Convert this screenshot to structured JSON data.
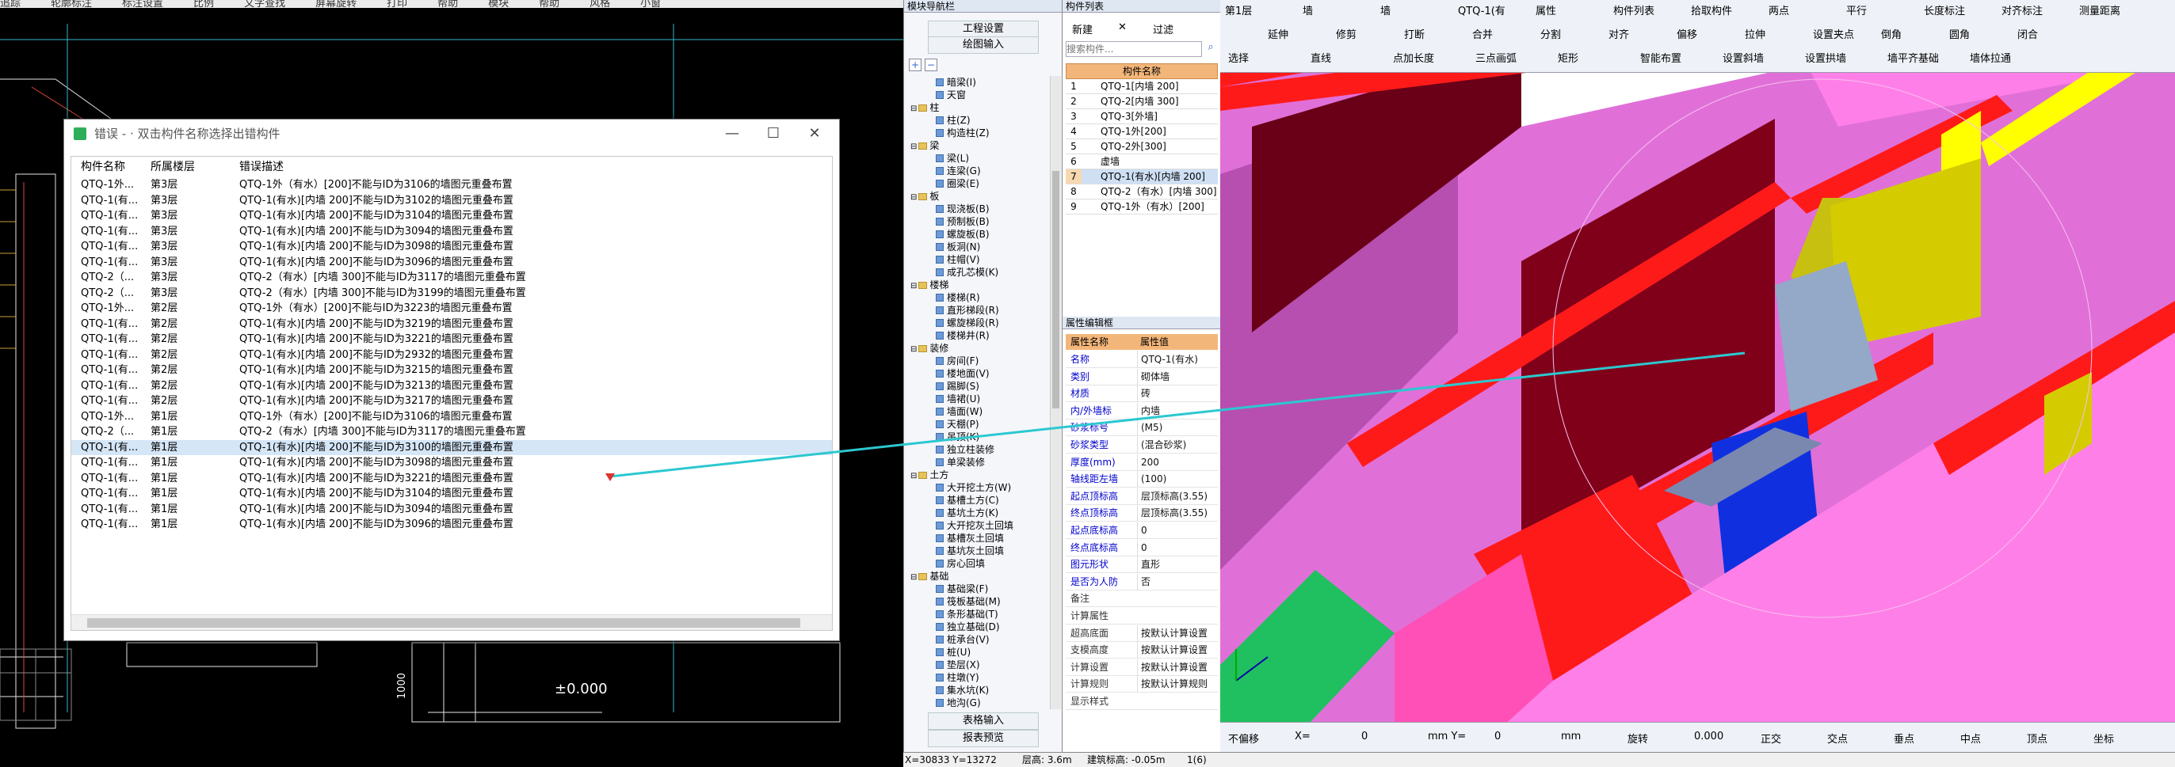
{
  "cad_menu": [
    "",
    "追踪",
    "轮廓标注",
    "标注设置",
    "比例",
    "文字查找",
    "屏幕旋转",
    "打印",
    "帮助",
    "模块",
    "",
    "帮助",
    "风格",
    "",
    "小窗"
  ],
  "cad_dimension": {
    "height_label": "1000",
    "elevation_label": "±0.000"
  },
  "error_dialog": {
    "title": "错误 - · 双击构件名称选择出错构件",
    "win_buttons": {
      "min": "—",
      "max": "☐",
      "close": "✕"
    },
    "columns": [
      "构件名称",
      "所属楼层",
      "错误描述"
    ],
    "rows": [
      {
        "name": "QTQ-1外...",
        "floor": "第3层",
        "desc": "QTQ-1外（有水）[200]不能与ID为3106的墙图元重叠布置"
      },
      {
        "name": "QTQ-1(有...",
        "floor": "第3层",
        "desc": "QTQ-1(有水)[内墙 200]不能与ID为3102的墙图元重叠布置"
      },
      {
        "name": "QTQ-1(有...",
        "floor": "第3层",
        "desc": "QTQ-1(有水)[内墙 200]不能与ID为3104的墙图元重叠布置"
      },
      {
        "name": "QTQ-1(有...",
        "floor": "第3层",
        "desc": "QTQ-1(有水)[内墙 200]不能与ID为3094的墙图元重叠布置"
      },
      {
        "name": "QTQ-1(有...",
        "floor": "第3层",
        "desc": "QTQ-1(有水)[内墙 200]不能与ID为3098的墙图元重叠布置"
      },
      {
        "name": "QTQ-1(有...",
        "floor": "第3层",
        "desc": "QTQ-1(有水)[内墙 200]不能与ID为3096的墙图元重叠布置"
      },
      {
        "name": "QTQ-2（...",
        "floor": "第3层",
        "desc": "QTQ-2（有水）[内墙 300]不能与ID为3117的墙图元重叠布置"
      },
      {
        "name": "QTQ-2（...",
        "floor": "第3层",
        "desc": "QTQ-2（有水）[内墙 300]不能与ID为3199的墙图元重叠布置"
      },
      {
        "name": "QTQ-1外...",
        "floor": "第2层",
        "desc": "QTQ-1外（有水）[200]不能与ID为3223的墙图元重叠布置"
      },
      {
        "name": "QTQ-1(有...",
        "floor": "第2层",
        "desc": "QTQ-1(有水)[内墙 200]不能与ID为3219的墙图元重叠布置"
      },
      {
        "name": "QTQ-1(有...",
        "floor": "第2层",
        "desc": "QTQ-1(有水)[内墙 200]不能与ID为3221的墙图元重叠布置"
      },
      {
        "name": "QTQ-1(有...",
        "floor": "第2层",
        "desc": "QTQ-1(有水)[内墙 200]不能与ID为2932的墙图元重叠布置"
      },
      {
        "name": "QTQ-1(有...",
        "floor": "第2层",
        "desc": "QTQ-1(有水)[内墙 200]不能与ID为3215的墙图元重叠布置"
      },
      {
        "name": "QTQ-1(有...",
        "floor": "第2层",
        "desc": "QTQ-1(有水)[内墙 200]不能与ID为3213的墙图元重叠布置"
      },
      {
        "name": "QTQ-1(有...",
        "floor": "第2层",
        "desc": "QTQ-1(有水)[内墙 200]不能与ID为3217的墙图元重叠布置"
      },
      {
        "name": "QTQ-1外...",
        "floor": "第1层",
        "desc": "QTQ-1外（有水）[200]不能与ID为3106的墙图元重叠布置"
      },
      {
        "name": "QTQ-2（...",
        "floor": "第1层",
        "desc": "QTQ-2（有水）[内墙 300]不能与ID为3117的墙图元重叠布置"
      },
      {
        "name": "QTQ-1(有...",
        "floor": "第1层",
        "desc": "QTQ-1(有水)[内墙 200]不能与ID为3100的墙图元重叠布置"
      },
      {
        "name": "QTQ-1(有...",
        "floor": "第1层",
        "desc": "QTQ-1(有水)[内墙 200]不能与ID为3098的墙图元重叠布置"
      },
      {
        "name": "QTQ-1(有...",
        "floor": "第1层",
        "desc": "QTQ-1(有水)[内墙 200]不能与ID为3221的墙图元重叠布置"
      },
      {
        "name": "QTQ-1(有...",
        "floor": "第1层",
        "desc": "QTQ-1(有水)[内墙 200]不能与ID为3104的墙图元重叠布置"
      },
      {
        "name": "QTQ-1(有...",
        "floor": "第1层",
        "desc": "QTQ-1(有水)[内墙 200]不能与ID为3094的墙图元重叠布置"
      },
      {
        "name": "QTQ-1(有...",
        "floor": "第1层",
        "desc": "QTQ-1(有水)[内墙 200]不能与ID为3096的墙图元重叠布置"
      }
    ],
    "selected_row_index": 17
  },
  "nav_panel": {
    "title": "模块导航栏",
    "buttons": [
      "工程设置",
      "绘图输入"
    ],
    "tree": [
      {
        "label": "暗梁(I)",
        "type": "item"
      },
      {
        "label": "天窗",
        "type": "item"
      },
      {
        "label": "柱",
        "type": "folder"
      },
      {
        "label": "柱(Z)",
        "type": "item"
      },
      {
        "label": "构造柱(Z)",
        "type": "item"
      },
      {
        "label": "梁",
        "type": "folder"
      },
      {
        "label": "梁(L)",
        "type": "item"
      },
      {
        "label": "连梁(G)",
        "type": "item"
      },
      {
        "label": "圈梁(E)",
        "type": "item"
      },
      {
        "label": "板",
        "type": "folder"
      },
      {
        "label": "现浇板(B)",
        "type": "item"
      },
      {
        "label": "预制板(B)",
        "type": "item"
      },
      {
        "label": "螺旋板(B)",
        "type": "item"
      },
      {
        "label": "板洞(N)",
        "type": "item"
      },
      {
        "label": "柱帽(V)",
        "type": "item"
      },
      {
        "label": "成孔芯模(K)",
        "type": "item"
      },
      {
        "label": "楼梯",
        "type": "folder"
      },
      {
        "label": "楼梯(R)",
        "type": "item"
      },
      {
        "label": "直形梯段(R)",
        "type": "item"
      },
      {
        "label": "螺旋梯段(R)",
        "type": "item"
      },
      {
        "label": "楼梯井(R)",
        "type": "item"
      },
      {
        "label": "装修",
        "type": "folder"
      },
      {
        "label": "房间(F)",
        "type": "item"
      },
      {
        "label": "楼地面(V)",
        "type": "item"
      },
      {
        "label": "踢脚(S)",
        "type": "item"
      },
      {
        "label": "墙裙(U)",
        "type": "item"
      },
      {
        "label": "墙面(W)",
        "type": "item"
      },
      {
        "label": "天棚(P)",
        "type": "item"
      },
      {
        "label": "吊顶(K)",
        "type": "item"
      },
      {
        "label": "独立柱装修",
        "type": "item"
      },
      {
        "label": "单梁装修",
        "type": "item"
      },
      {
        "label": "土方",
        "type": "folder"
      },
      {
        "label": "大开挖土方(W)",
        "type": "item"
      },
      {
        "label": "基槽土方(C)",
        "type": "item"
      },
      {
        "label": "基坑土方(K)",
        "type": "item"
      },
      {
        "label": "大开挖灰土回填",
        "type": "item"
      },
      {
        "label": "基槽灰土回填",
        "type": "item"
      },
      {
        "label": "基坑灰土回填",
        "type": "item"
      },
      {
        "label": "房心回填",
        "type": "item"
      },
      {
        "label": "基础",
        "type": "folder"
      },
      {
        "label": "基础梁(F)",
        "type": "item"
      },
      {
        "label": "筏板基础(M)",
        "type": "item"
      },
      {
        "label": "条形基础(T)",
        "type": "item"
      },
      {
        "label": "独立基础(D)",
        "type": "item"
      },
      {
        "label": "桩承台(V)",
        "type": "item"
      },
      {
        "label": "桩(U)",
        "type": "item"
      },
      {
        "label": "垫层(X)",
        "type": "item"
      },
      {
        "label": "柱墩(Y)",
        "type": "item"
      },
      {
        "label": "集水坑(K)",
        "type": "item"
      },
      {
        "label": "地沟(G)",
        "type": "item"
      }
    ],
    "bottom_buttons": [
      "表格输入",
      "报表预览"
    ]
  },
  "component_list": {
    "title": "构件列表",
    "toolbar": [
      "新建",
      "✕",
      "过滤"
    ],
    "search_placeholder": "搜索构件...",
    "header": "构件名称",
    "items": [
      "QTQ-1[内墙 200]",
      "QTQ-2[内墙 300]",
      "QTQ-3[外墙]",
      "QTQ-1外[200]",
      "QTQ-2外[300]",
      "虚墙",
      "QTQ-1(有水)[内墙 200]",
      "QTQ-2（有水）[内墙 300]",
      "QTQ-1外（有水）[200]"
    ],
    "selected_index": 6
  },
  "property_editor": {
    "title": "属性编辑框",
    "header": [
      "属性名称",
      "属性值"
    ],
    "rows": [
      {
        "k": "名称",
        "v": "QTQ-1(有水)"
      },
      {
        "k": "类别",
        "v": "砌体墙"
      },
      {
        "k": "材质",
        "v": "砖"
      },
      {
        "k": "内/外墙标",
        "v": "内墙"
      },
      {
        "k": "砂浆标号",
        "v": "(M5)"
      },
      {
        "k": "砂浆类型",
        "v": "(混合砂浆)"
      },
      {
        "k": "厚度(mm)",
        "v": "200"
      },
      {
        "k": "轴线距左墙",
        "v": "(100)"
      },
      {
        "k": "起点顶标高",
        "v": "层顶标高(3.55)"
      },
      {
        "k": "终点顶标高",
        "v": "层顶标高(3.55)"
      },
      {
        "k": "起点底标高",
        "v": "0"
      },
      {
        "k": "终点底标高",
        "v": "0"
      },
      {
        "k": "图元形状",
        "v": "直形"
      },
      {
        "k": "是否为人防",
        "v": "否"
      },
      {
        "k": "备注",
        "v": ""
      },
      {
        "k": "计算属性",
        "v": ""
      },
      {
        "k": "超高底面",
        "v": "按默认计算设置"
      },
      {
        "k": "支模高度",
        "v": "按默认计算设置"
      },
      {
        "k": "计算设置",
        "v": "按默认计算设置"
      },
      {
        "k": "计算规则",
        "v": "按默认计算规则"
      },
      {
        "k": "显示样式",
        "v": ""
      }
    ]
  },
  "view_toolbar": {
    "row1": [
      "第1层",
      "墙",
      "墙",
      "QTQ-1(有",
      "属性",
      "构件列表",
      "拾取构件",
      "两点",
      "平行",
      "长度标注",
      "对齐标注",
      "测量距离"
    ],
    "row2": [
      "延伸",
      "修剪",
      "打断",
      "合并",
      "分割",
      "对齐",
      "偏移",
      "拉伸",
      "设置夹点",
      "倒角",
      "圆角",
      "闭合"
    ],
    "row3": [
      "选择",
      "直线",
      "点加长度",
      "三点画弧",
      "矩形",
      "智能布置",
      "设置斜墙",
      "设置拱墙",
      "墙平齐基础",
      "墙体拉通"
    ]
  },
  "view_status": {
    "items": [
      "不偏移",
      "X=",
      "0",
      "mm Y=",
      "0",
      "mm",
      "旋转",
      "0.000",
      "正交",
      "交点",
      "垂点",
      "中点",
      "顶点",
      "坐标"
    ]
  },
  "status_bar": {
    "coords": "X=30833  Y=13272",
    "floor_height": "层高: 3.6m",
    "base_elev": "建筑标高: -0.05m",
    "count": "1(6)"
  },
  "colors": {
    "accent_selection": "#d5e6f7",
    "wall_magenta": "#f07fe0",
    "beam_red": "#ff1a1a",
    "slab_yellow": "#ffff00",
    "connector_cyan": "#2cc8d0"
  }
}
